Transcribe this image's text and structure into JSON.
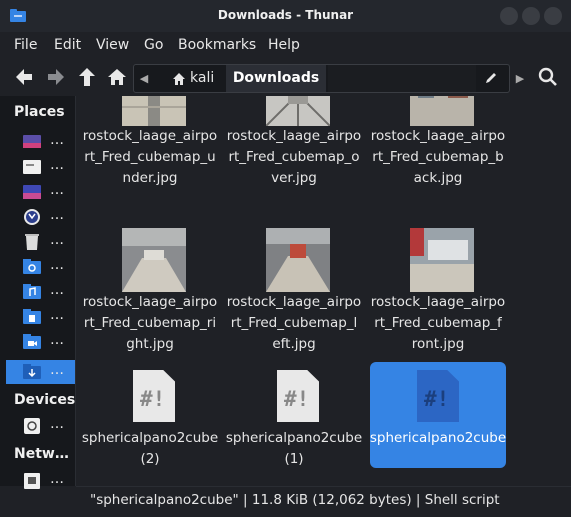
{
  "window": {
    "title": "Downloads - Thunar"
  },
  "menu": [
    "File",
    "Edit",
    "View",
    "Go",
    "Bookmarks",
    "Help"
  ],
  "toolbar": {
    "home_crumb": "kali",
    "current_crumb": "Downloads"
  },
  "sidebar": {
    "places_heading": "Places",
    "devices_heading": "Devices",
    "network_heading": "Netw…",
    "items": [
      {
        "icon": "desktop-icon",
        "label": "…"
      },
      {
        "icon": "drive-icon",
        "label": "…"
      },
      {
        "icon": "folder-icon",
        "label": "…"
      },
      {
        "icon": "app-icon",
        "label": "…"
      },
      {
        "icon": "trash-icon",
        "label": "…"
      },
      {
        "icon": "folder-link-icon",
        "label": "…"
      },
      {
        "icon": "folder-music-icon",
        "label": "…"
      },
      {
        "icon": "folder-docs-icon",
        "label": "…"
      },
      {
        "icon": "folder-video-icon",
        "label": "…"
      },
      {
        "icon": "folder-download-icon",
        "label": "…"
      },
      {
        "icon": "disk-icon",
        "label": "…"
      },
      {
        "icon": "network-icon",
        "label": "…"
      }
    ]
  },
  "files": [
    {
      "name": "rostock_laage_airport_Fred_cubemap_under.jpg",
      "line1": "rostock_laage_airpo",
      "line2": "rt_Fred_cubemap_u",
      "line3": "nder.jpg"
    },
    {
      "name": "rostock_laage_airport_Fred_cubemap_over.jpg",
      "line1": "rostock_laage_airpo",
      "line2": "rt_Fred_cubemap_o",
      "line3": "ver.jpg"
    },
    {
      "name": "rostock_laage_airport_Fred_cubemap_back.jpg",
      "line1": "rostock_laage_airpo",
      "line2": "rt_Fred_cubemap_b",
      "line3": "ack.jpg"
    },
    {
      "name": "rostock_laage_airport_Fred_cubemap_right.jpg",
      "line1": "rostock_laage_airpo",
      "line2": "rt_Fred_cubemap_ri",
      "line3": "ght.jpg"
    },
    {
      "name": "rostock_laage_airport_Fred_cubemap_left.jpg",
      "line1": "rostock_laage_airpo",
      "line2": "rt_Fred_cubemap_l",
      "line3": "eft.jpg"
    },
    {
      "name": "rostock_laage_airport_Fred_cubemap_front.jpg",
      "line1": "rostock_laage_airpo",
      "line2": "rt_Fred_cubemap_f",
      "line3": "ront.jpg"
    },
    {
      "name": "sphericalpano2cube (2)",
      "line1": "sphericalpano2cube",
      "line2": "(2)",
      "line3": ""
    },
    {
      "name": "sphericalpano2cube (1)",
      "line1": "sphericalpano2cube",
      "line2": "(1)",
      "line3": ""
    },
    {
      "name": "sphericalpano2cube",
      "line1": "sphericalpano2cube",
      "line2": "",
      "line3": ""
    }
  ],
  "script_mark": "#!",
  "status": "\"sphericalpano2cube\" | 11.8 KiB (12,062 bytes) | Shell script",
  "colors": {
    "accent": "#3584e4",
    "background": "#1f2126",
    "sidebar": "#16181c"
  }
}
